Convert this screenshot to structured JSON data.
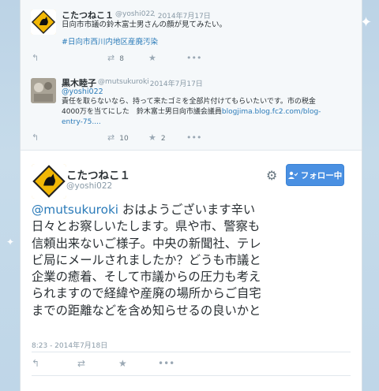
{
  "tweets": [
    {
      "name": "こたつねこ１",
      "handle": "@yoshi022",
      "date": "· 2014年7月17日",
      "line1": "日向市市議の鈴木富士男さんの顔が見てみたい。",
      "hashtag": "#日向市西川内地区産廃汚染",
      "retweets": "8"
    },
    {
      "name": "黒木睦子",
      "handle": "@mutsukuroki",
      "date": "· 2014年7月17日",
      "mention": "@yoshi022",
      "line1": "責任を取らないなら、持って来たゴミを全部片付けてもらいたいです。市の税金",
      "line2_text": "4000万を当てにした　鈴木富士男日向市議会議員",
      "line2_link": "blogjima.blog.fc2.com/blog-",
      "line3_link": "entry-75....",
      "retweets": "10",
      "favorites": "2"
    }
  ],
  "main": {
    "name": "こたつねこ１",
    "handle": "@yoshi022",
    "follow_label": "フォロー中",
    "mention": "@mutsukuroki",
    "line1": "  おはようございます辛い",
    "line2": "日々とお察しいたします。県や市、警察も",
    "line3": "信頼出来ないご様子。中央の新聞社、テレ",
    "line4": "ビ局にメールされましたか？どうも市議と",
    "line5": "企業の癒着、そして市議からの圧力も考え",
    "line6": "られますので経緯や産廃の場所からご自宅",
    "line7": "までの距離などを含め知らせるの良いかと",
    "timestamp": "8:23 - 2014年7月18日"
  },
  "icons": {
    "reply": "reply-icon",
    "retweet": "retweet-icon",
    "favorite": "star-icon",
    "more": "more-icon",
    "settings": "gear-icon"
  },
  "colors": {
    "link": "#2b7bb9",
    "follow_button": "#4a90e2",
    "background": "#c3d8e9"
  }
}
